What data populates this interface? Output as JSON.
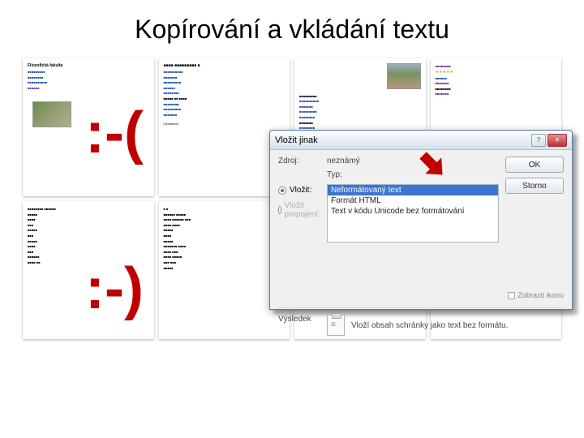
{
  "page": {
    "title": "Kopírování a vkládání textu"
  },
  "emoticons": {
    "sad": ":-(",
    "happy": ":-)"
  },
  "thumbs": {
    "stars": "★★★★★"
  },
  "dialog": {
    "title": "Vložit jinak",
    "source_label": "Zdroj:",
    "source_value": "neznámý",
    "type_label": "Typ:",
    "radio_paste": "Vložit:",
    "radio_link": "Vložit propojení:",
    "options": {
      "opt1": "Neformátovaný text",
      "opt2": "Formát HTML",
      "opt3": "Text v kódu Unicode bez formátování"
    },
    "buttons": {
      "ok": "OK",
      "cancel": "Storno"
    },
    "show_icon": "Zobrazit ikonu",
    "result_label": "Výsledek",
    "result_desc": "Vloží obsah schránky jako text bez formátu.",
    "win_help": "?",
    "win_close": "✕"
  }
}
